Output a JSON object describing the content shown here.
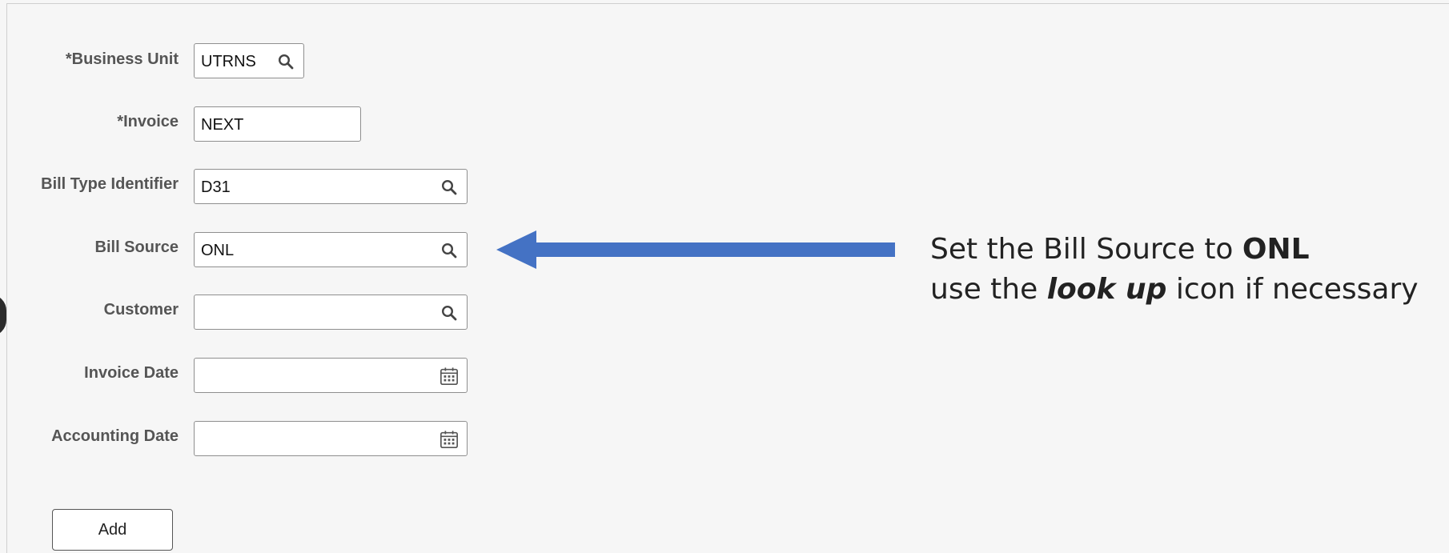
{
  "form": {
    "business_unit": {
      "label": "*Business Unit",
      "value": "UTRNS",
      "icon": "search-icon"
    },
    "invoice": {
      "label": "*Invoice",
      "value": "NEXT"
    },
    "bill_type": {
      "label": "Bill Type Identifier",
      "value": "D31",
      "icon": "search-icon"
    },
    "bill_source": {
      "label": "Bill Source",
      "value": "ONL",
      "icon": "search-icon"
    },
    "customer": {
      "label": "Customer",
      "value": "",
      "icon": "search-icon"
    },
    "invoice_date": {
      "label": "Invoice Date",
      "value": "",
      "icon": "calendar-icon"
    },
    "accounting_date": {
      "label": "Accounting Date",
      "value": "",
      "icon": "calendar-icon"
    },
    "add_button": "Add"
  },
  "annotation": {
    "line1_prefix": "Set the Bill Source to ",
    "line1_bold": "ONL",
    "line2_prefix": "use the ",
    "line2_bold_italic": "look up",
    "line2_suffix": " icon if necessary",
    "arrow_color": "#4472c4"
  }
}
